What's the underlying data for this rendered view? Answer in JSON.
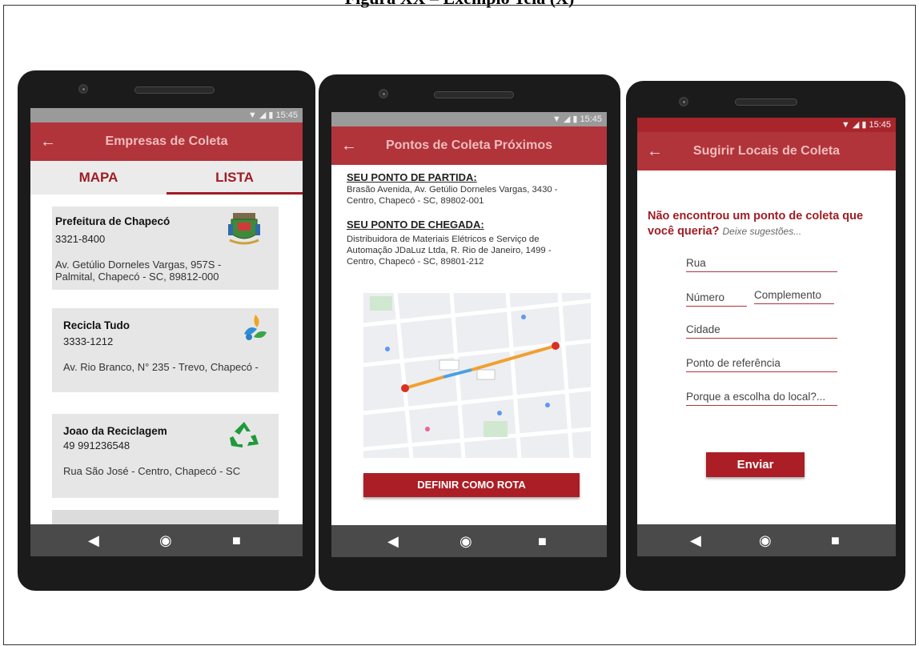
{
  "caption": "Figura XX – Exemplo Tela (X)",
  "status": {
    "time": "15:45",
    "icons": "▼ ◢ ▮"
  },
  "nav": {
    "back": "◀",
    "home": "◉",
    "recent": "■"
  },
  "appbar_back": "←",
  "screen1": {
    "title": "Empresas de Coleta",
    "tabs": [
      "MAPA",
      "LISTA"
    ],
    "active_tab": "LISTA",
    "companies": [
      {
        "name": "Prefeitura de Chapecó",
        "phone": "3321-8400",
        "address_l1": "Av. Getúlio Dorneles Vargas, 957S -",
        "address_l2": "Palmital, Chapecó - SC, 89812-000",
        "logo": "municipal-crest-icon"
      },
      {
        "name": "Recicla Tudo",
        "phone": "3333-1212",
        "address_l1": "Av. Rio Branco, N° 235 - Trevo, Chapecó -",
        "address_l2": "",
        "logo": "recycling-shapes-icon"
      },
      {
        "name": "Joao da Reciclagem",
        "phone": "49 991236548",
        "address_l1": "Rua São José - Centro, Chapecó - SC",
        "address_l2": "",
        "logo": "green-recycle-icon"
      }
    ]
  },
  "screen2": {
    "title": "Pontos de Coleta Próximos",
    "start_heading": "SEU PONTO DE PARTIDA:",
    "start_l1": "Brasão Avenida, Av. Getúlio Dorneles Vargas, 3430 -",
    "start_l2": "Centro, Chapecó - SC, 89802-001",
    "end_heading": "SEU PONTO DE CHEGADA:",
    "end_l1": "Distribuidora de Materiais Elétricos e Serviço de",
    "end_l2": "Automação JDaLuz Ltda, R. Rio de Janeiro, 1499 -",
    "end_l3": "Centro, Chapecó - SC, 89801-212",
    "button": "DEFINIR COMO ROTA"
  },
  "screen3": {
    "title": "Sugirir Locais de Coleta",
    "question": "Não encontrou um ponto de coleta que você queria?",
    "hint": "Deixe sugestões...",
    "fields": {
      "street": "Rua",
      "number": "Número",
      "complement": "Complemento",
      "city": "Cidade",
      "reference": "Ponto de referência",
      "reason": "Porque a escolha do local?..."
    },
    "button": "Enviar"
  }
}
